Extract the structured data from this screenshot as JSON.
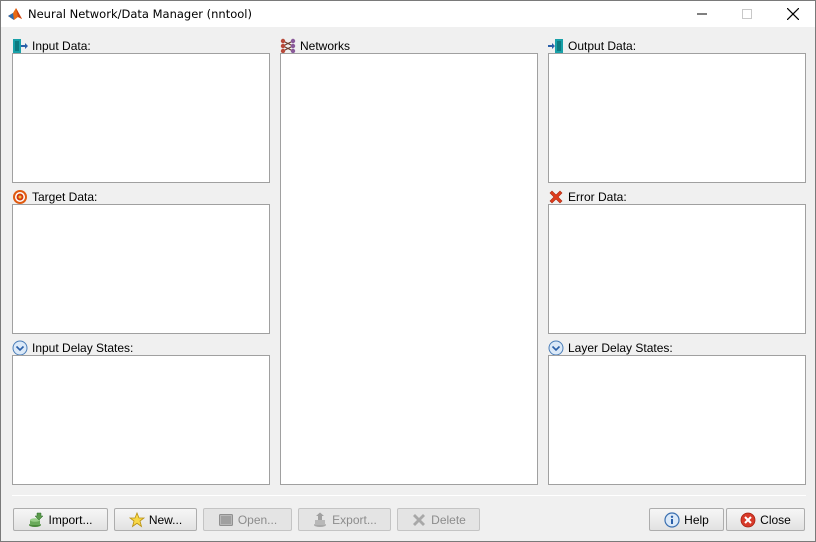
{
  "window": {
    "title": "Neural Network/Data Manager (nntool)"
  },
  "panels": {
    "input_data": {
      "label": "Input Data:",
      "icon": "input-data-icon"
    },
    "target_data": {
      "label": "Target Data:",
      "icon": "target-icon"
    },
    "input_delay_states": {
      "label": "Input Delay States:",
      "icon": "delay-icon"
    },
    "networks": {
      "label": "Networks",
      "icon": "network-icon"
    },
    "output_data": {
      "label": "Output Data:",
      "icon": "output-data-icon"
    },
    "error_data": {
      "label": "Error Data:",
      "icon": "error-icon"
    },
    "layer_delay_states": {
      "label": "Layer Delay States:",
      "icon": "delay-icon"
    }
  },
  "buttons": {
    "import": "Import...",
    "new": "New...",
    "open": "Open...",
    "export": "Export...",
    "delete": "Delete",
    "help": "Help",
    "close": "Close"
  },
  "colors": {
    "window_bg": "#f0f0f0",
    "list_bg": "#ffffff",
    "disabled_text": "#8c8c8c",
    "error_red": "#e03c1c",
    "target_orange": "#e05a10"
  }
}
